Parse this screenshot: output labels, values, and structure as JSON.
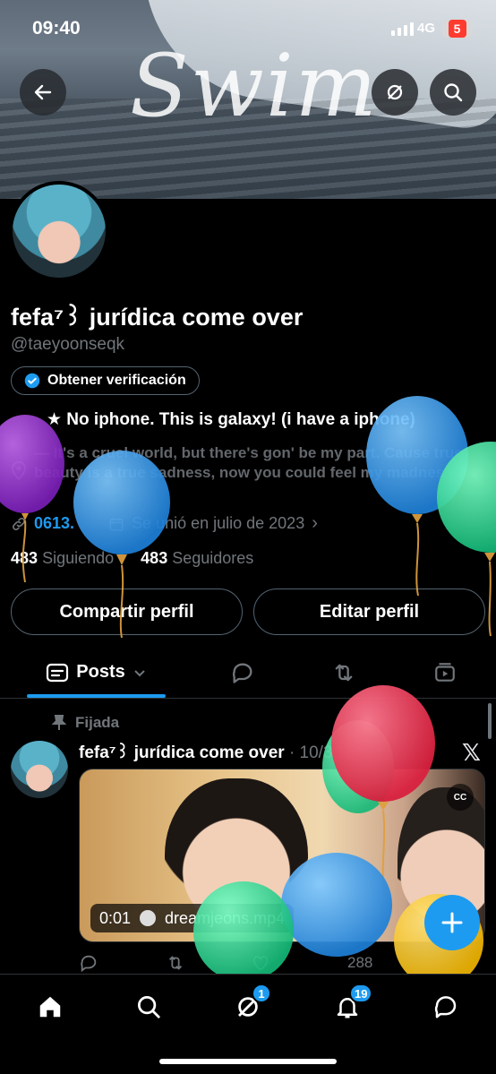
{
  "status_bar": {
    "time": "09:40",
    "network": "4G",
    "battery": "5"
  },
  "banner": {
    "title": "Swim"
  },
  "profile": {
    "name": "fefa⁷꒱ jurídica come over",
    "handle": "@taeyoonseqk",
    "verify_label": "Obtener verificación",
    "bio_line1": "★ No iphone. This is galaxy! (i have a iphone)",
    "bio_line2": "— It's a cruel world, but there's gon' be my part. Cause true beauty is a true sadness, now you could feel my madness",
    "link": "0613.",
    "joined": "Se unió en julio de 2023",
    "following_count": "483",
    "following_label": "Siguiendo",
    "followers_count": "483",
    "followers_label": "Seguidores",
    "share_button": "Compartir perfil",
    "edit_button": "Editar perfil"
  },
  "tabs": {
    "posts_label": "Posts"
  },
  "post": {
    "pinned_label": "Fijada",
    "author": "fefa⁷꒱ jurídica come over",
    "meta": "· 10/3/25",
    "video_time": "0:01",
    "video_source": "dreamjeons.mp4",
    "cc_label": "CC",
    "stat_views": "288"
  },
  "bottom_nav": {
    "messages_badge": "1",
    "notifications_badge": "19"
  },
  "colors": {
    "accent": "#1d9bf0",
    "background": "#000000",
    "muted": "#71767b"
  }
}
